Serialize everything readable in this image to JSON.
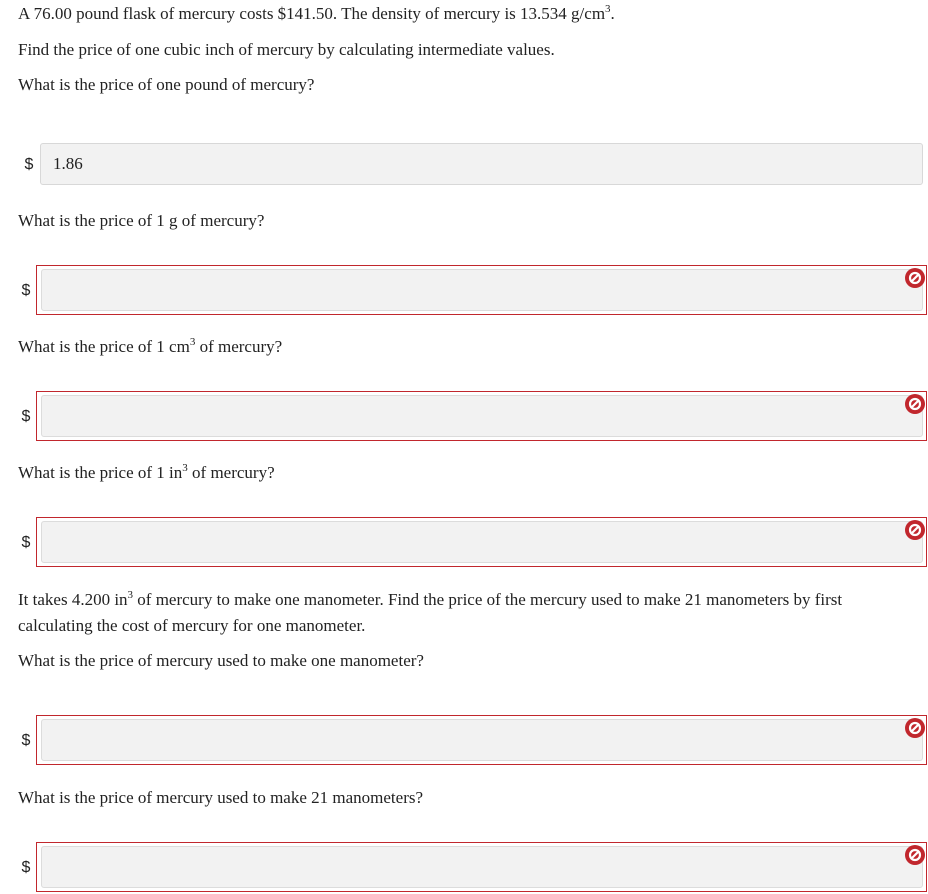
{
  "intro": {
    "line1_before": "A 76.00 pound flask of mercury costs $141.50. The density of mercury is 13.534 g/cm",
    "line1_sup": "3",
    "line1_after": ".",
    "line2": "Find the price of one cubic inch of mercury by calculating intermediate values."
  },
  "currency_symbol": "$",
  "q1": {
    "text": "What is the price of one pound of mercury?",
    "value": "1.86"
  },
  "q2": {
    "text": "What is the price of 1 g of mercury?",
    "value": ""
  },
  "q3": {
    "before": "What is the price of 1 cm",
    "sup": "3",
    "after": " of mercury?",
    "value": ""
  },
  "q4": {
    "before": "What is the price of 1 in",
    "sup": "3",
    "after": " of mercury?",
    "value": ""
  },
  "part2": {
    "before": "It takes 4.200 in",
    "sup": "3",
    "after": " of mercury to make one manometer. Find the price of the mercury used to make 21 manometers by first calculating the cost of mercury for one manometer."
  },
  "q5": {
    "text": "What is the price of mercury used to make one manometer?",
    "value": ""
  },
  "q6": {
    "text": "What is the price of mercury used to make 21 manometers?",
    "value": ""
  },
  "colors": {
    "error": "#c1272d",
    "field_bg": "#f2f2f2",
    "text": "#222222"
  },
  "icons": {
    "error_icon": "prohibited-circle-icon"
  }
}
